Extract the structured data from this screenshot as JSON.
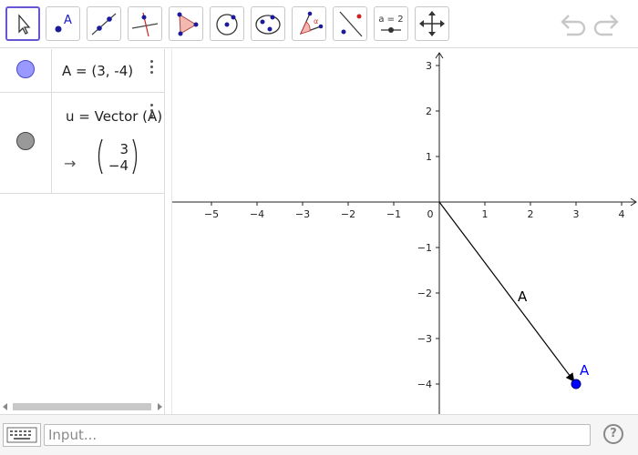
{
  "toolbar": {
    "tools": [
      {
        "name": "move",
        "label": ""
      },
      {
        "name": "point",
        "label": ""
      },
      {
        "name": "line",
        "label": ""
      },
      {
        "name": "perpendicular-line",
        "label": ""
      },
      {
        "name": "polygon",
        "label": ""
      },
      {
        "name": "circle-center-point",
        "label": ""
      },
      {
        "name": "ellipse",
        "label": ""
      },
      {
        "name": "angle",
        "label": ""
      },
      {
        "name": "reflect-about-line",
        "label": ""
      },
      {
        "name": "slider",
        "label": "a = 2"
      },
      {
        "name": "move-graphics-view",
        "label": ""
      }
    ],
    "selected": "move"
  },
  "algebra": {
    "rows": [
      {
        "marker_color": "#9999ff",
        "text": "A = (3, -4)"
      },
      {
        "marker_color": "#999999",
        "definition": "u = Vector (A)",
        "arrow": "→",
        "vector_top": "3",
        "vector_bottom": "−4"
      }
    ]
  },
  "graphics": {
    "x_ticks": [
      "−5",
      "−4",
      "−3",
      "−2",
      "−1",
      "0",
      "1",
      "2",
      "3",
      "4"
    ],
    "y_ticks_pos": [
      "3",
      "2",
      "1"
    ],
    "y_ticks_neg": [
      "−1",
      "−2",
      "−3",
      "−4"
    ],
    "vector_label": "A",
    "point_label": "A",
    "point": {
      "x": 3,
      "y": -4
    },
    "point_color": "#0000ff",
    "vector_color": "#000000"
  },
  "input": {
    "placeholder": "Input...",
    "help": "?"
  }
}
